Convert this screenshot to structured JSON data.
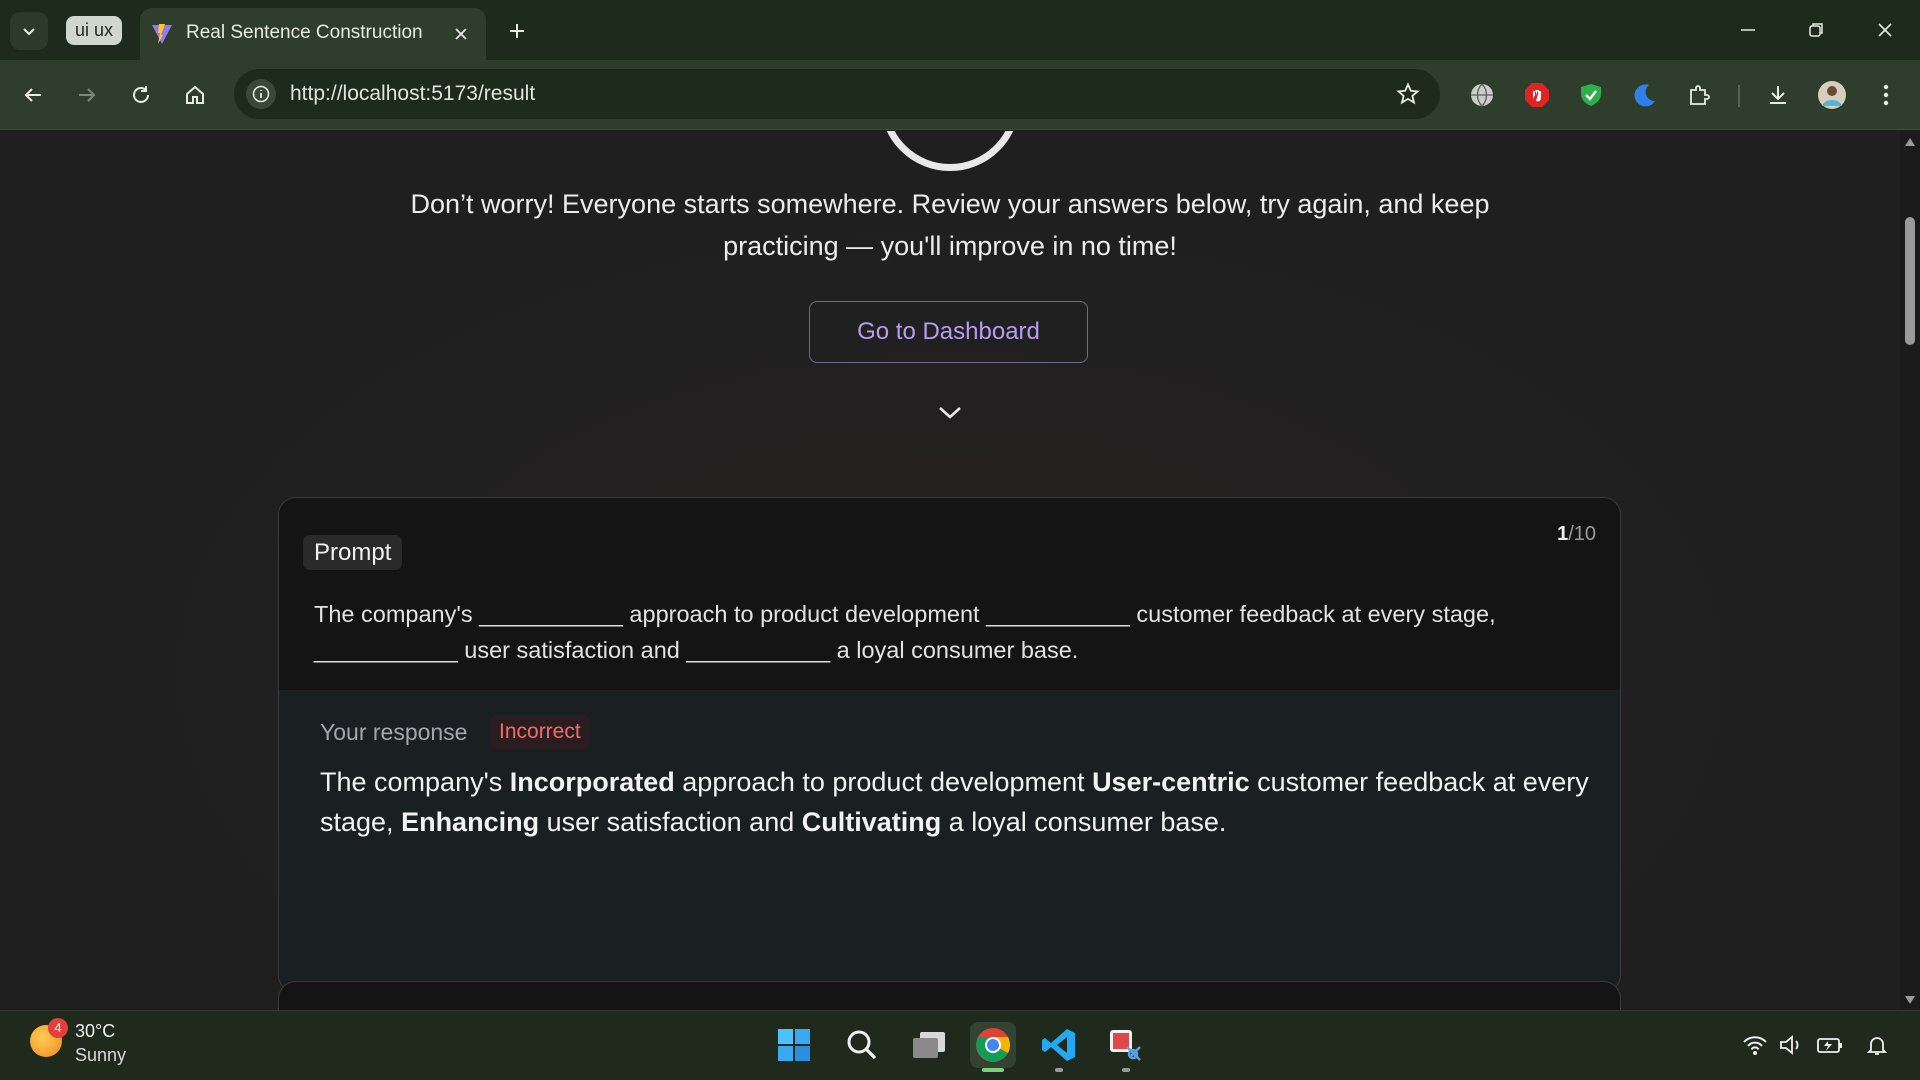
{
  "browser": {
    "tab_group_label": "ui ux",
    "tab_title": "Real Sentence Construction",
    "url": "http://localhost:5173/result"
  },
  "page": {
    "message": "Don’t worry! Everyone starts somewhere. Review your answers below, try again, and keep practicing — you'll improve in no time!",
    "dashboard_button": "Go to Dashboard"
  },
  "card": {
    "prompt_label": "Prompt",
    "counter_current": "1",
    "counter_total": "/10",
    "prompt_text": "The company's ___________ approach to product development ___________ customer feedback at every stage, ___________ user satisfaction and ___________ a loyal consumer base.",
    "response_label": "Your response",
    "status_badge": "Incorrect",
    "response": {
      "p1": "The company's ",
      "w1": "Incorporated",
      "p2": " approach to product development ",
      "w2": "User-centric",
      "p3": " customer feedback at every stage, ",
      "w3": "Enhancing",
      "p4": " user satisfaction and ",
      "w4": "Cultivating",
      "p5": " a loyal consumer base."
    }
  },
  "taskbar": {
    "weather_temp": "30°C",
    "weather_condition": "Sunny",
    "weather_badge": "4"
  },
  "colors": {
    "accent": "#b89cf2",
    "incorrect": "#f06c6c",
    "chrome": "#2f3d2c"
  },
  "icons": [
    "tab-search-icon",
    "vite-icon",
    "close-icon",
    "plus-icon",
    "minimize-icon",
    "restore-icon",
    "back-icon",
    "forward-icon",
    "reload-icon",
    "home-icon",
    "info-icon",
    "star-icon",
    "globe-icon",
    "adblock-icon",
    "shield-icon",
    "moon-icon",
    "puzzle-icon",
    "download-icon",
    "avatar",
    "more-icon",
    "chevron-down-icon",
    "windows-icon",
    "search-icon",
    "task-view-icon",
    "chrome-icon",
    "vscode-icon",
    "snipping-tool-icon",
    "wifi-icon",
    "volume-icon",
    "battery-icon",
    "bell-icon"
  ]
}
